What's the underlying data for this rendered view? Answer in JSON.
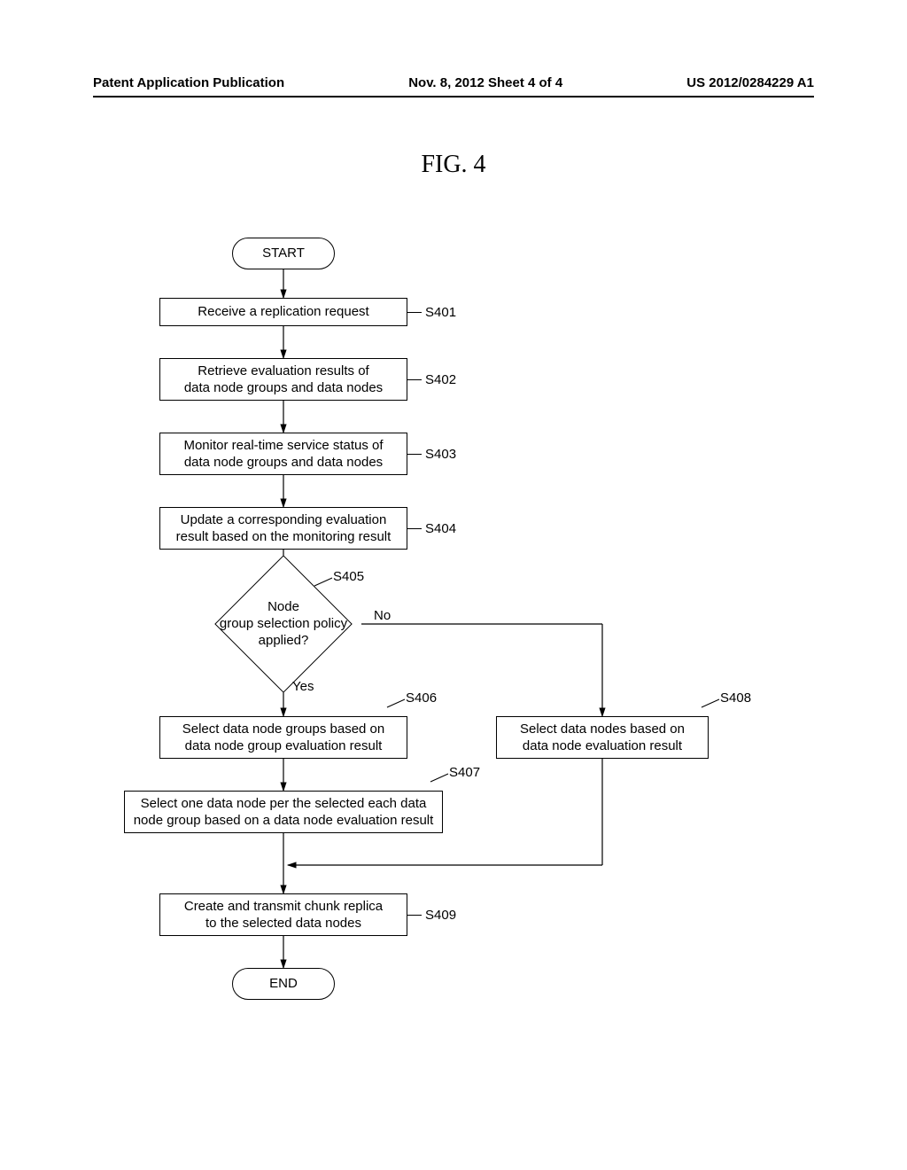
{
  "header": {
    "left": "Patent Application Publication",
    "center": "Nov. 8, 2012  Sheet 4 of 4",
    "right": "US 2012/0284229 A1"
  },
  "figure_title": "FIG. 4",
  "nodes": {
    "start": "START",
    "s401": "Receive a replication request",
    "s402": "Retrieve evaluation results of\ndata node groups and data nodes",
    "s403": "Monitor real-time service status of\ndata node groups and data nodes",
    "s404": "Update a corresponding evaluation\nresult based on the monitoring result",
    "s405": "Node\ngroup selection policy\napplied?",
    "s406": "Select data node groups based on\ndata node group evaluation result",
    "s407": "Select one data node per the selected each data\nnode group based on a data node evaluation result",
    "s408": "Select data nodes based on\ndata node evaluation result",
    "s409": "Create and transmit chunk replica\nto the selected data nodes",
    "end": "END"
  },
  "step_labels": {
    "s401": "S401",
    "s402": "S402",
    "s403": "S403",
    "s404": "S404",
    "s405": "S405",
    "s406": "S406",
    "s407": "S407",
    "s408": "S408",
    "s409": "S409"
  },
  "edge_labels": {
    "yes": "Yes",
    "no": "No"
  },
  "chart_data": {
    "type": "flowchart",
    "title": "FIG. 4",
    "nodes": [
      {
        "id": "start",
        "type": "terminal",
        "text": "START"
      },
      {
        "id": "s401",
        "type": "process",
        "text": "Receive a replication request",
        "label": "S401"
      },
      {
        "id": "s402",
        "type": "process",
        "text": "Retrieve evaluation results of data node groups and data nodes",
        "label": "S402"
      },
      {
        "id": "s403",
        "type": "process",
        "text": "Monitor real-time service status of data node groups and data nodes",
        "label": "S403"
      },
      {
        "id": "s404",
        "type": "process",
        "text": "Update a corresponding evaluation result based on the monitoring result",
        "label": "S404"
      },
      {
        "id": "s405",
        "type": "decision",
        "text": "Node group selection policy applied?",
        "label": "S405"
      },
      {
        "id": "s406",
        "type": "process",
        "text": "Select data node groups based on data node group evaluation result",
        "label": "S406"
      },
      {
        "id": "s407",
        "type": "process",
        "text": "Select one data node per the selected each data node group based on a data node evaluation result",
        "label": "S407"
      },
      {
        "id": "s408",
        "type": "process",
        "text": "Select data nodes based on data node evaluation result",
        "label": "S408"
      },
      {
        "id": "s409",
        "type": "process",
        "text": "Create and transmit chunk replica to the selected data nodes",
        "label": "S409"
      },
      {
        "id": "end",
        "type": "terminal",
        "text": "END"
      }
    ],
    "edges": [
      {
        "from": "start",
        "to": "s401"
      },
      {
        "from": "s401",
        "to": "s402"
      },
      {
        "from": "s402",
        "to": "s403"
      },
      {
        "from": "s403",
        "to": "s404"
      },
      {
        "from": "s404",
        "to": "s405"
      },
      {
        "from": "s405",
        "to": "s406",
        "label": "Yes"
      },
      {
        "from": "s405",
        "to": "s408",
        "label": "No"
      },
      {
        "from": "s406",
        "to": "s407"
      },
      {
        "from": "s407",
        "to": "s409"
      },
      {
        "from": "s408",
        "to": "s409"
      },
      {
        "from": "s409",
        "to": "end"
      }
    ]
  }
}
